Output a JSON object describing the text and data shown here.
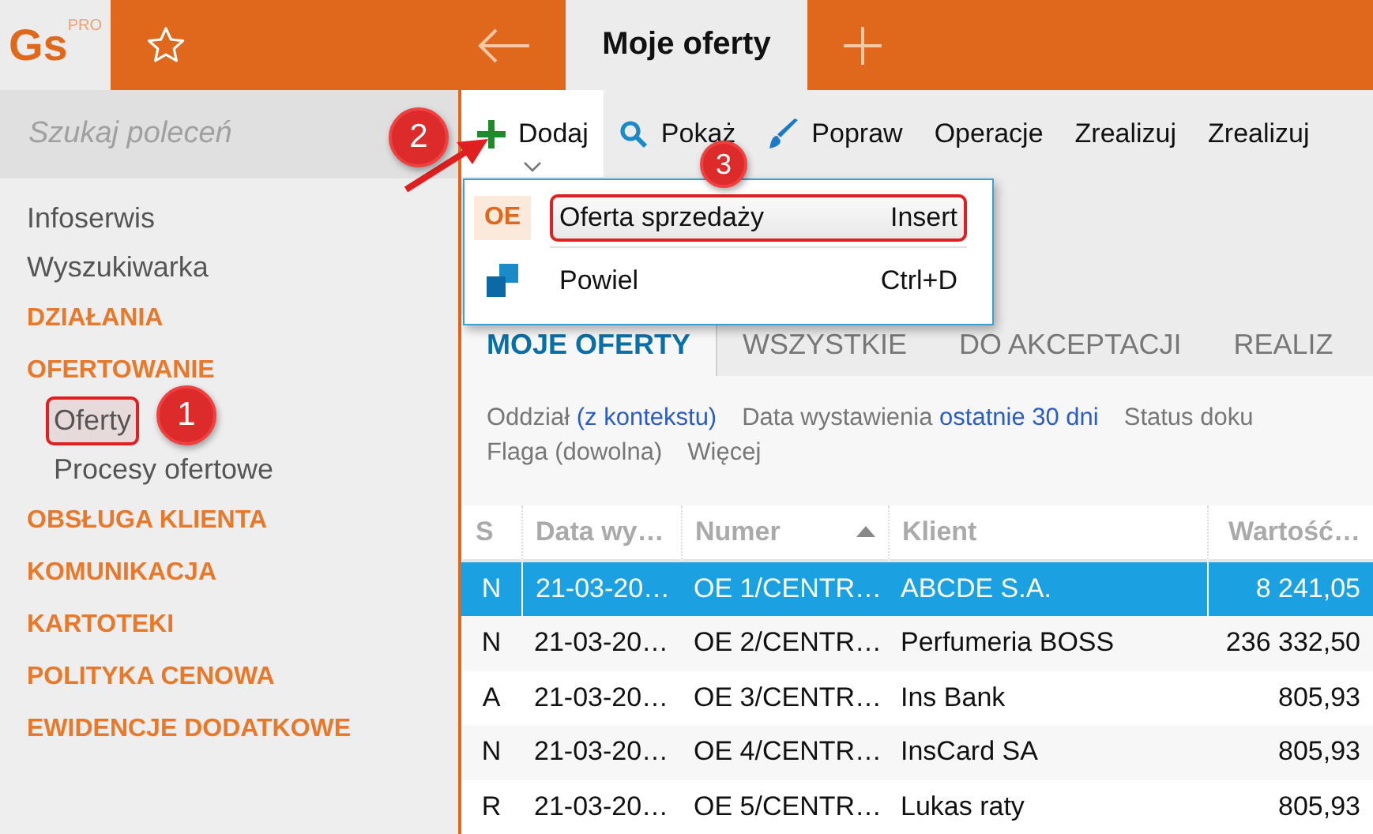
{
  "logo": {
    "text": "Gs",
    "superscript": "PRO"
  },
  "window": {
    "tabs": [
      {
        "label": "Moje oferty",
        "selected": true
      }
    ]
  },
  "sidebar": {
    "search": {
      "placeholder": "Szukaj poleceń"
    },
    "items": [
      {
        "label": "Infoserwis",
        "kind": "link"
      },
      {
        "label": "Wyszukiwarka",
        "kind": "link"
      },
      {
        "label": "DZIAŁANIA",
        "kind": "section"
      },
      {
        "label": "OFERTOWANIE",
        "kind": "section",
        "children": [
          {
            "label": "Oferty",
            "selected": true,
            "outlined": true
          },
          {
            "label": "Procesy ofertowe",
            "selected": false,
            "outlined": false
          }
        ]
      },
      {
        "label": "OBSŁUGA KLIENTA",
        "kind": "section"
      },
      {
        "label": "KOMUNIKACJA",
        "kind": "section"
      },
      {
        "label": "KARTOTEKI",
        "kind": "section"
      },
      {
        "label": "POLITYKA CENOWA",
        "kind": "section"
      },
      {
        "label": "EWIDENCJE DODATKOWE",
        "kind": "section"
      }
    ]
  },
  "toolbar": [
    {
      "label": "Dodaj",
      "kind": "add",
      "selected": true
    },
    {
      "label": "Pokaż",
      "kind": "search",
      "selected": false
    },
    {
      "label": "Popraw",
      "kind": "edit",
      "selected": false
    },
    {
      "label": "Operacje",
      "kind": "text",
      "selected": false
    },
    {
      "label": "Zrealizuj",
      "kind": "text",
      "selected": false
    },
    {
      "label": "Zrealizuj",
      "kind": "text",
      "selected": false
    }
  ],
  "menu": [
    {
      "kind": "code",
      "code": "OE",
      "label": "Oferta sprzedaży",
      "shortcut": "Insert",
      "outlined": true
    },
    {
      "kind": "duplicate",
      "label": "Powiel",
      "shortcut": "Ctrl+D",
      "outlined": false
    }
  ],
  "tabs": [
    {
      "label": "MOJE OFERTY",
      "selected": true
    },
    {
      "label": "WSZYSTKIE",
      "selected": false
    },
    {
      "label": "DO AKCEPTACJI",
      "selected": false
    },
    {
      "label": "REALIZ",
      "selected": false
    }
  ],
  "filters": [
    [
      {
        "label": "Oddział",
        "value": "(z kontekstu)"
      },
      {
        "label": "Data wystawienia",
        "value": "ostatnie 30 dni"
      },
      {
        "label": "Status doku"
      }
    ],
    [
      {
        "label": "Flaga (dowolna)"
      },
      {
        "label": "Więcej"
      }
    ]
  ],
  "table": {
    "columns": [
      {
        "label": "S",
        "sorted": false
      },
      {
        "label": "Data wy…",
        "sorted": false
      },
      {
        "label": "Numer",
        "sorted": true
      },
      {
        "label": "Klient",
        "sorted": false
      },
      {
        "label": "Wartość…",
        "sorted": false
      }
    ],
    "rows": [
      {
        "s": "N",
        "date": "21-03-20…",
        "number": "OE 1/CENTR…",
        "client": "ABCDE S.A.",
        "value": "8 241,05",
        "selected": true
      },
      {
        "s": "N",
        "date": "21-03-20…",
        "number": "OE 2/CENTR…",
        "client": "Perfumeria BOSS",
        "value": "236 332,50",
        "selected": false
      },
      {
        "s": "A",
        "date": "21-03-20…",
        "number": "OE 3/CENTR…",
        "client": "Ins Bank",
        "value": "805,93",
        "selected": false
      },
      {
        "s": "N",
        "date": "21-03-20…",
        "number": "OE 4/CENTR…",
        "client": "InsCard SA",
        "value": "805,93",
        "selected": false
      },
      {
        "s": "R",
        "date": "21-03-20…",
        "number": "OE 5/CENTR…",
        "client": "Lukas raty",
        "value": "805,93",
        "selected": false
      }
    ]
  },
  "annotations": [
    "1",
    "2",
    "3"
  ]
}
